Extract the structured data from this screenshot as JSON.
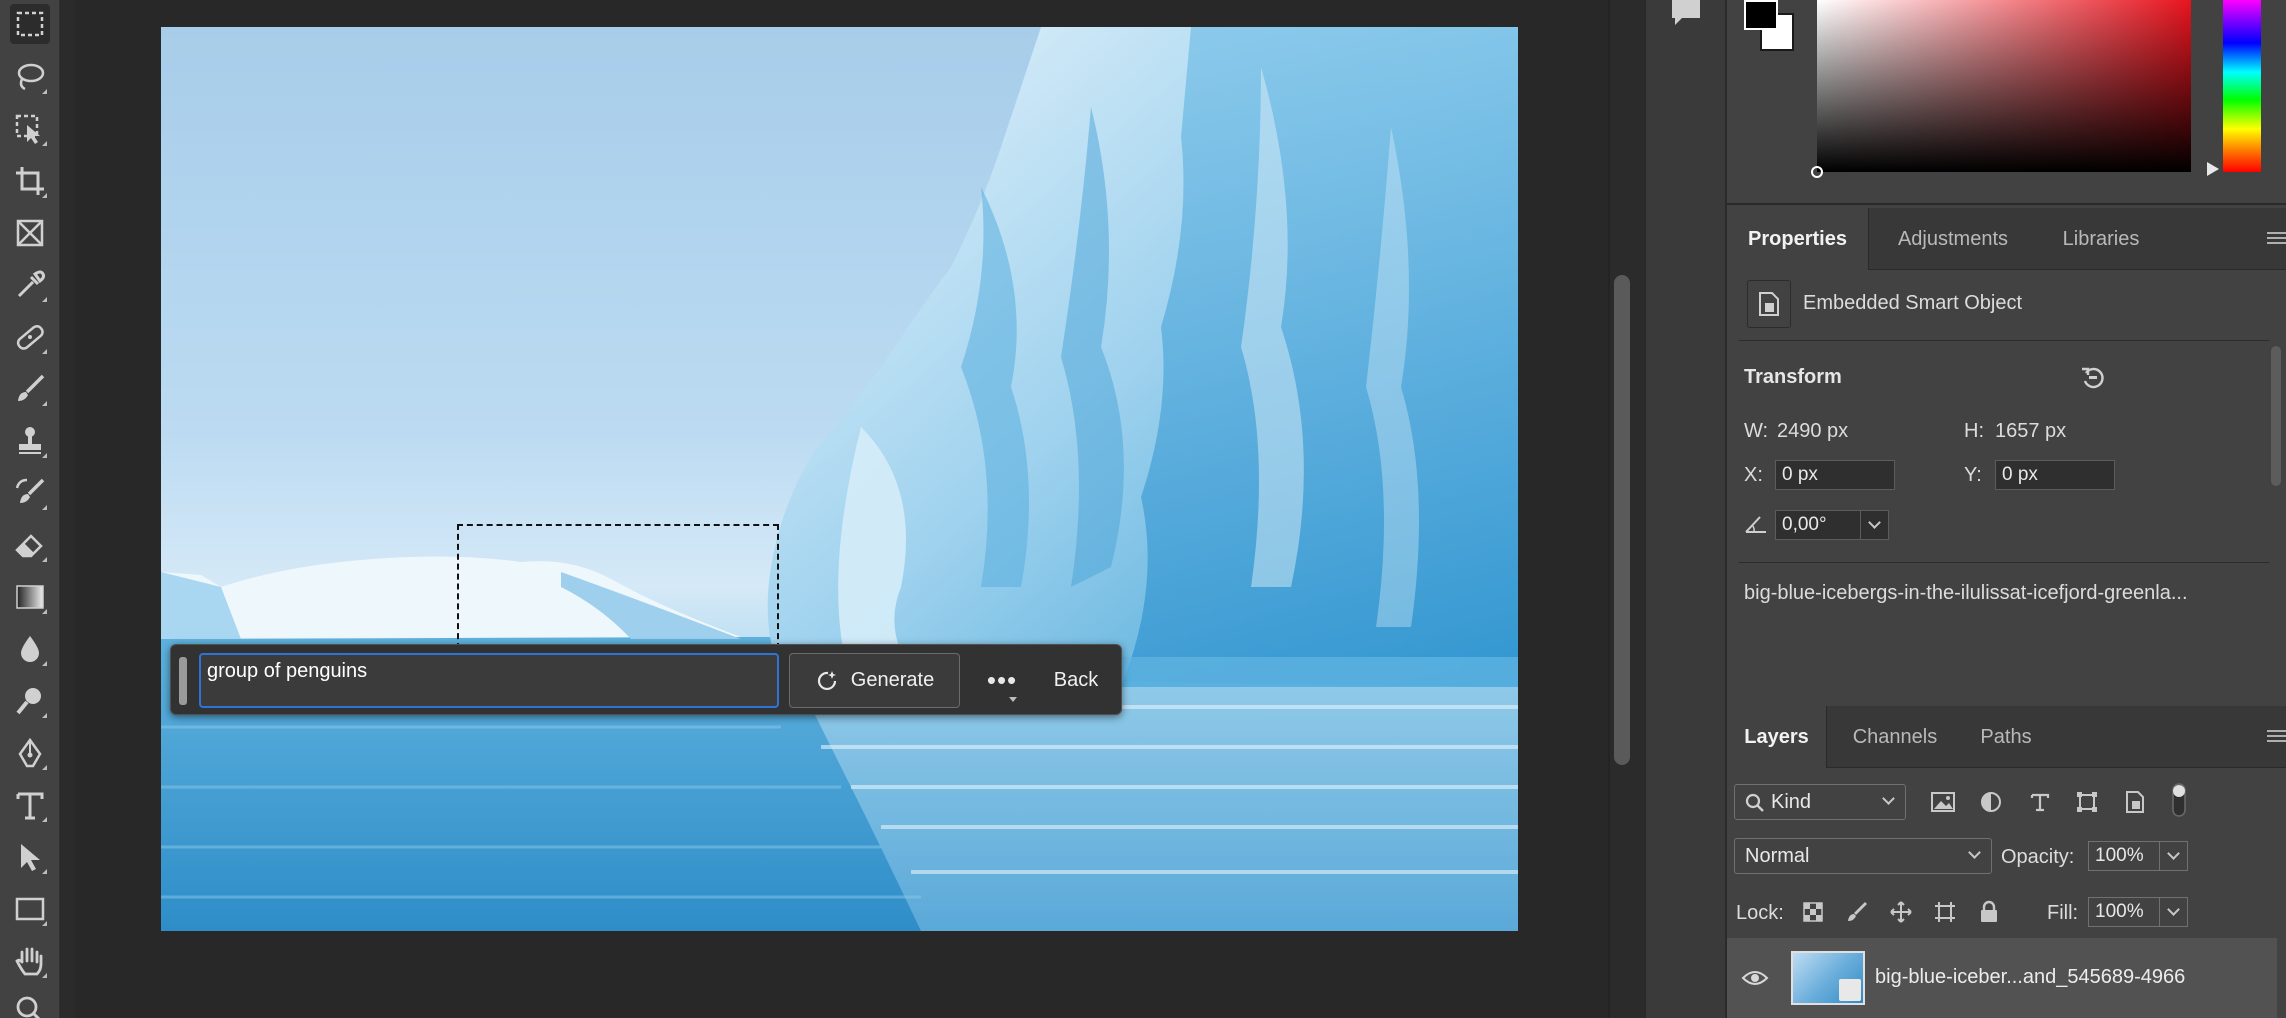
{
  "toolbar": {
    "tools": [
      "rectangular-marquee",
      "lasso",
      "object-selection",
      "crop",
      "frame",
      "eyedropper",
      "spot-healing-brush",
      "brush",
      "clone-stamp",
      "history-brush",
      "eraser",
      "gradient",
      "blur",
      "dodge",
      "pen",
      "type",
      "path-selection",
      "rectangle",
      "hand",
      "zoom"
    ]
  },
  "taskbar": {
    "prompt_value": "group of penguins",
    "generate_label": "Generate",
    "more_label": "•••",
    "back_label": "Back"
  },
  "properties": {
    "tabs": [
      "Properties",
      "Adjustments",
      "Libraries"
    ],
    "object_type": "Embedded Smart Object",
    "transform_label": "Transform",
    "w_label": "W:",
    "w_value": "2490 px",
    "h_label": "H:",
    "h_value": "1657 px",
    "x_label": "X:",
    "x_value": "0 px",
    "y_label": "Y:",
    "y_value": "0 px",
    "angle_value": "0,00°",
    "filename": "big-blue-icebergs-in-the-ilulissat-icefjord-greenla..."
  },
  "layers": {
    "tabs": [
      "Layers",
      "Channels",
      "Paths"
    ],
    "filter_kind": "Kind",
    "blend_mode": "Normal",
    "opacity_label": "Opacity:",
    "opacity_value": "100%",
    "lock_label": "Lock:",
    "fill_label": "Fill:",
    "fill_value": "100%",
    "layer_name": "big-blue-iceber...and_545689-4966"
  },
  "colors": {
    "foreground": "#000000",
    "background": "#ffffff",
    "accent": "#2e73d6"
  }
}
